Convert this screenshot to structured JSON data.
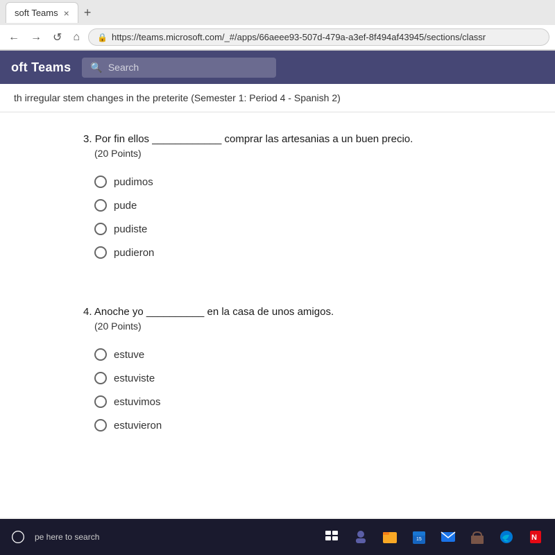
{
  "browser": {
    "tab_title": "soft Teams",
    "tab_close": "×",
    "tab_new": "+",
    "url": "https://teams.microsoft.com/_#/apps/66aeee93-507d-479a-a3ef-8f494af43945/sections/classr",
    "nav_back": "←",
    "nav_forward": "→",
    "nav_refresh": "↺",
    "nav_home": "⌂"
  },
  "teams": {
    "logo": "oft Teams",
    "search_placeholder": "Search"
  },
  "page": {
    "title": "th irregular stem changes in the preterite (Semester 1: Period 4 - Spanish 2)"
  },
  "questions": [
    {
      "number": "3.",
      "text": "Por fin ellos ____________ comprar las artesanias a un buen precio.",
      "points": "(20 Points)",
      "options": [
        "pudimos",
        "pude",
        "pudiste",
        "pudieron"
      ]
    },
    {
      "number": "4.",
      "text": "Anoche yo __________ en la casa de unos amigos.",
      "points": "(20 Points)",
      "options": [
        "estuve",
        "estuviste",
        "estuvimos",
        "estuvieron"
      ]
    }
  ],
  "taskbar": {
    "search_placeholder": "pe here to search",
    "icons": [
      "windows",
      "task-view",
      "teams",
      "file-explorer",
      "calendar",
      "mail",
      "store",
      "edge",
      "netflix"
    ]
  }
}
